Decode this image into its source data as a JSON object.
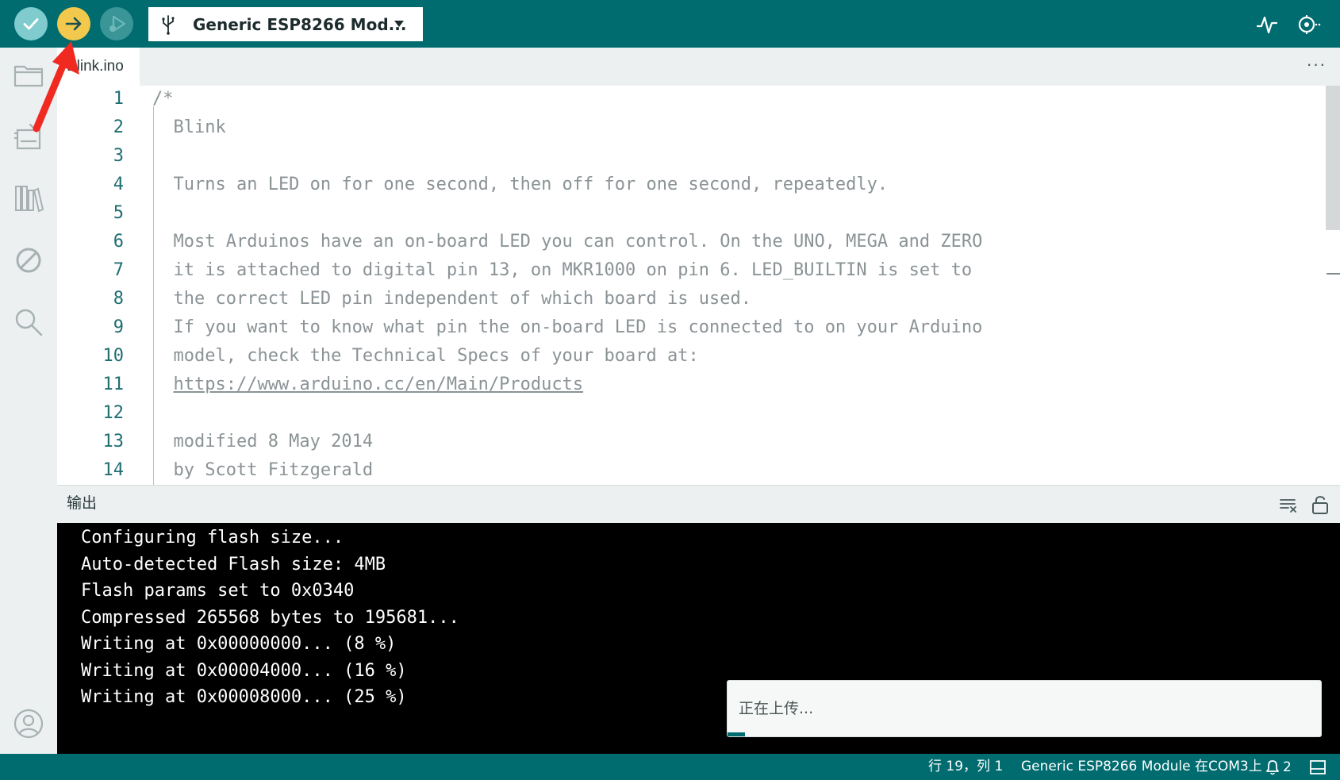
{
  "toolbar": {
    "verify_icon": "check-icon",
    "upload_icon": "arrow-right-icon",
    "debug_icon": "debug-icon",
    "board_selector": {
      "icon": "usb-icon",
      "label": "Generic ESP8266 Mod...",
      "caret_icon": "caret-down-icon"
    },
    "plotter_icon": "serial-plotter-icon",
    "monitor_icon": "serial-monitor-icon",
    "colors": {
      "bar": "#006c6f",
      "verify": "#7fcbcd",
      "upload": "#f2c94c",
      "debug": "#3a9597"
    }
  },
  "sidebar": {
    "items": [
      {
        "name": "sketchbook",
        "icon": "folder-icon"
      },
      {
        "name": "boards-manager",
        "icon": "board-icon"
      },
      {
        "name": "library-manager",
        "icon": "library-icon"
      },
      {
        "name": "debug",
        "icon": "no-debug-icon"
      },
      {
        "name": "search",
        "icon": "search-icon"
      }
    ],
    "account_icon": "account-icon"
  },
  "tabs": {
    "active": "Blink.ino",
    "more_label": "···"
  },
  "editor": {
    "lines": [
      {
        "n": "1",
        "text": "/*"
      },
      {
        "n": "2",
        "text": "  Blink"
      },
      {
        "n": "3",
        "text": ""
      },
      {
        "n": "4",
        "text": "  Turns an LED on for one second, then off for one second, repeatedly."
      },
      {
        "n": "5",
        "text": ""
      },
      {
        "n": "6",
        "text": "  Most Arduinos have an on-board LED you can control. On the UNO, MEGA and ZERO"
      },
      {
        "n": "7",
        "text": "  it is attached to digital pin 13, on MKR1000 on pin 6. LED_BUILTIN is set to"
      },
      {
        "n": "8",
        "text": "  the correct LED pin independent of which board is used."
      },
      {
        "n": "9",
        "text": "  If you want to know what pin the on-board LED is connected to on your Arduino"
      },
      {
        "n": "10",
        "text": "  model, check the Technical Specs of your board at:"
      },
      {
        "n": "11",
        "text": "  ",
        "url": "https://www.arduino.cc/en/Main/Products"
      },
      {
        "n": "12",
        "text": ""
      },
      {
        "n": "13",
        "text": "  modified 8 May 2014"
      },
      {
        "n": "14",
        "text": "  by Scott Fitzgerald"
      }
    ]
  },
  "output": {
    "title": "输出",
    "clear_icon": "clear-output-icon",
    "lock_icon": "unlock-icon",
    "lines": [
      "Configuring flash size...",
      "Auto-detected Flash size: 4MB",
      "Flash params set to 0x0340",
      "Compressed 265568 bytes to 195681...",
      "Writing at 0x00000000... (8 %)",
      "Writing at 0x00004000... (16 %)",
      "Writing at 0x00008000... (25 %)"
    ]
  },
  "toast": {
    "message": "正在上传...",
    "progress": 0.03
  },
  "statusbar": {
    "position": "行 19，列 1",
    "board": "Generic ESP8266 Module 在COM3上",
    "notification_icon": "bell-icon",
    "notification_count": "2",
    "panel_icon": "toggle-panel-icon"
  },
  "annotation": {
    "icon": "red-arrow-icon",
    "color": "#f02a21"
  }
}
